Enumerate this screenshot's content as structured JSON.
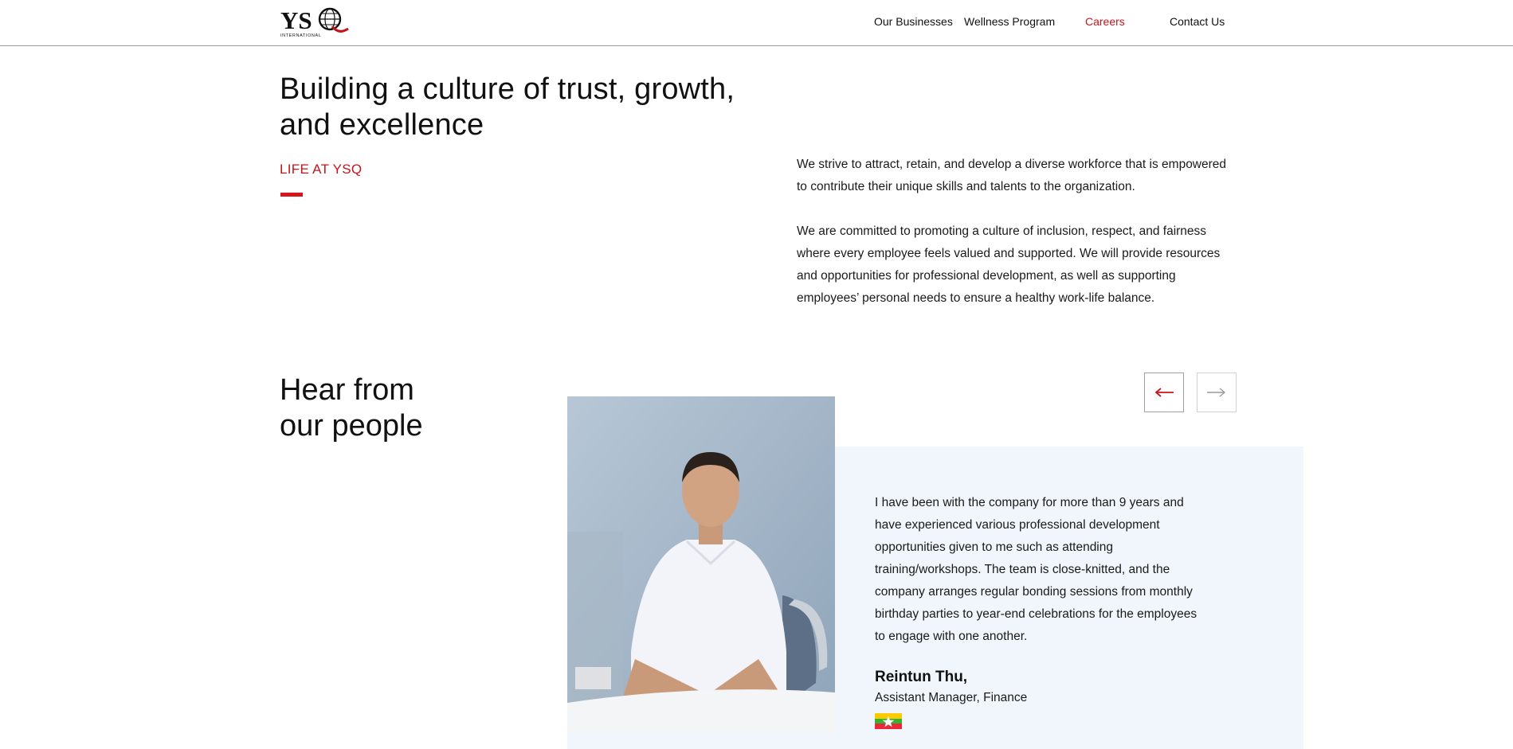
{
  "brand": {
    "logo_text": "YSQ",
    "logo_subtext": "INTERNATIONAL",
    "accent_color": "#c3161c"
  },
  "nav": {
    "items": [
      {
        "label": "Our Businesses",
        "active": false
      },
      {
        "label": "Wellness Program",
        "active": false
      },
      {
        "label": "Careers",
        "active": true
      },
      {
        "label": "Contact Us",
        "active": false
      }
    ]
  },
  "intro": {
    "headline_line1": "Building a culture of trust, growth,",
    "headline_line2": "and excellence",
    "eyebrow": "LIFE AT YSQ",
    "paragraph1": "We strive to attract, retain, and develop a diverse workforce that is empowered to contribute their unique skills and talents to the organization.",
    "paragraph2": "We are committed to promoting a culture of inclusion, respect, and fairness where every employee feels valued and supported. We will provide resources and opportunities for professional development, as well as supporting employees’ personal needs to ensure a healthy work-life balance."
  },
  "testimonials": {
    "title_line1": "Hear from",
    "title_line2": "our people",
    "prev_icon": "arrow-left-icon",
    "next_icon": "arrow-right-icon",
    "current": {
      "quote": "I have been with the company for more than 9 years and have experienced various professional development opportunities given to me such as attending training/workshops. The team is close-knitted, and the company arranges regular bonding sessions from monthly birthday parties to year-end celebrations for the employees to engage with one another.",
      "name": "Reintun Thu,",
      "role": "Assistant Manager, Finance",
      "flag_icon": "myanmar-flag-icon"
    }
  }
}
